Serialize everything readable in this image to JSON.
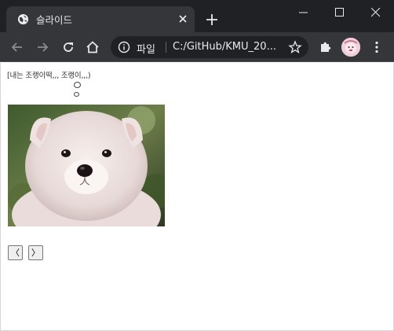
{
  "tab": {
    "title": "슬라이드",
    "favicon": "globe-icon"
  },
  "omnibox": {
    "scheme_label": "파일",
    "url": "C:/GitHub/KMU_20..."
  },
  "page": {
    "caption": "[내는 조랭이떡,,, 조랭이,,,)",
    "prev_label": "〈",
    "next_label": "〉",
    "image_subject": "samoyed-puppy"
  },
  "colors": {
    "titlebar": "#202124",
    "tab_active": "#35363a",
    "text_light": "#e8eaed",
    "page_bg": "#ffffff"
  }
}
